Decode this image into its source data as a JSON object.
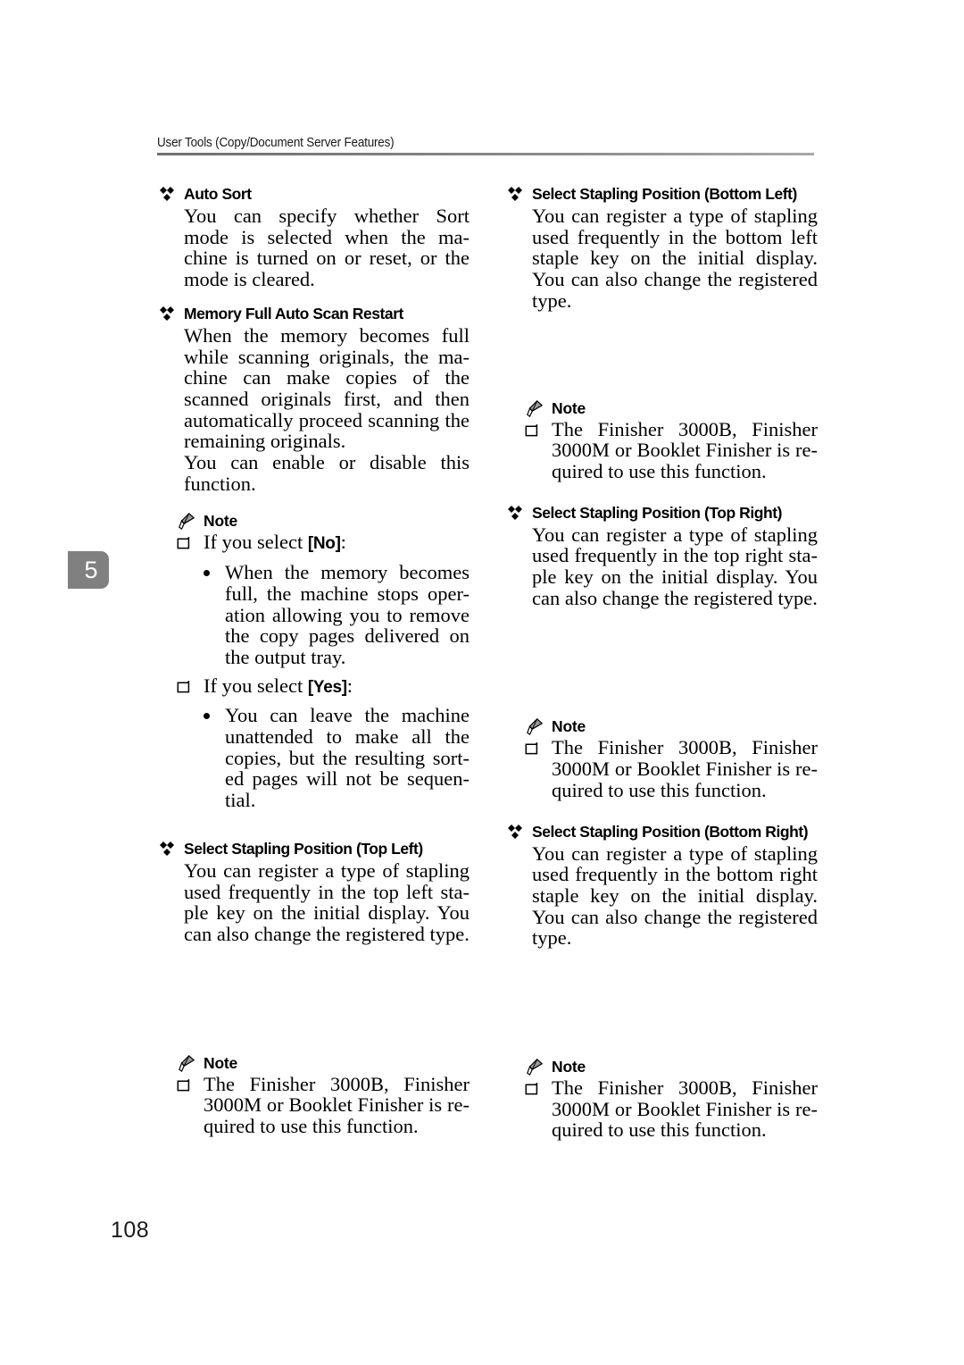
{
  "page": {
    "running_header": "User Tools (Copy/Document Server Features)",
    "chapter_number": "5",
    "folio": "108",
    "rule_color": "#8a8a8a",
    "tab_color": "#808080"
  },
  "icons": {
    "diamond": "diamond-bullet-icon",
    "pencil": "pencil-note-icon",
    "square": "square-bullet-icon",
    "dot": "round-bullet-icon"
  },
  "left_column": {
    "sections": [
      {
        "heading": "Auto Sort",
        "paragraphs": [
          "You can specify whether Sort mode is selected when the ma-chine is turned on or reset, or the mode is cleared."
        ]
      },
      {
        "heading": "Memory Full Auto Scan Restart",
        "paragraphs": [
          "When the memory becomes full while scanning originals, the ma-chine can make copies of the scanned originals first, and then automatically proceed scanning the remaining originals.",
          "You can enable or disable this function."
        ],
        "note": {
          "label": "Note",
          "items": [
            {
              "text_before": "If you select ",
              "key": "[No]",
              "text_after": ":",
              "subitems": [
                "When the memory becomes full, the machine stops oper-ation allowing you to remove the copy pages delivered on the output tray."
              ]
            },
            {
              "text_before": "If you select ",
              "key": "[Yes]",
              "text_after": ":",
              "subitems": [
                "You can leave the machine unattended to make all the copies, but the resulting sort-ed pages will not be sequen-tial."
              ]
            }
          ]
        }
      },
      {
        "heading": "Select Stapling Position (Top Left)",
        "paragraphs": [
          "You can register a type of stapling used frequently in the top left sta-ple key on the initial display. You can also change the registered type."
        ],
        "note": {
          "label": "Note",
          "items": [
            {
              "text_before": "The Finisher 3000B, Finisher 3000M or Booklet Finisher is re-quired to use this function.",
              "key": "",
              "text_after": "",
              "subitems": []
            }
          ]
        }
      }
    ]
  },
  "right_column": {
    "sections": [
      {
        "heading": "Select Stapling Position (Bottom Left)",
        "paragraphs": [
          "You can register a type of stapling used frequently in the bottom left staple key on the initial display. You can also change the registered type."
        ],
        "note": {
          "label": "Note",
          "items": [
            {
              "text_before": "The Finisher 3000B, Finisher 3000M or Booklet Finisher is re-quired to use this function.",
              "key": "",
              "text_after": "",
              "subitems": []
            }
          ]
        }
      },
      {
        "heading": "Select Stapling Position (Top Right)",
        "paragraphs": [
          "You can register a type of stapling used frequently in the top right sta-ple key on the initial display. You can also change the registered type."
        ],
        "note": {
          "label": "Note",
          "items": [
            {
              "text_before": "The Finisher 3000B, Finisher 3000M or Booklet Finisher is re-quired to use this function.",
              "key": "",
              "text_after": "",
              "subitems": []
            }
          ]
        }
      },
      {
        "heading": "Select Stapling Position (Bottom Right)",
        "paragraphs": [
          "You can register a type of stapling used frequently in the bottom right staple key on the initial display. You can also change the registered type."
        ],
        "note": {
          "label": "Note",
          "items": [
            {
              "text_before": "The Finisher 3000B, Finisher 3000M or Booklet Finisher is re-quired to use this function.",
              "key": "",
              "text_after": "",
              "subitems": []
            }
          ]
        }
      }
    ]
  }
}
